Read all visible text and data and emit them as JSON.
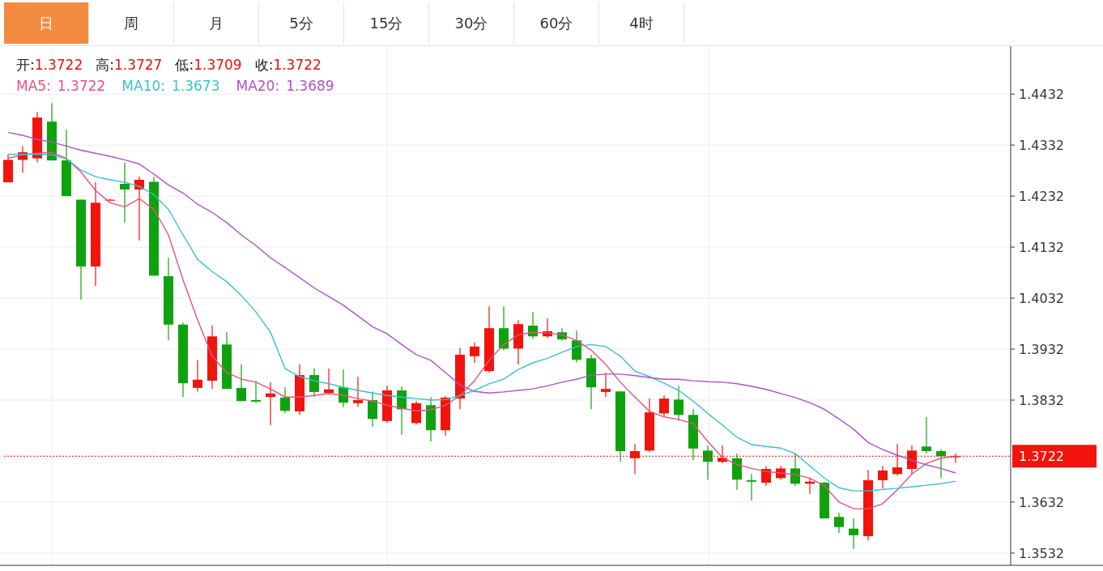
{
  "tabs": [
    {
      "label": "日",
      "selected": true
    },
    {
      "label": "周",
      "selected": false
    },
    {
      "label": "月",
      "selected": false
    },
    {
      "label": "5分",
      "selected": false
    },
    {
      "label": "15分",
      "selected": false
    },
    {
      "label": "30分",
      "selected": false
    },
    {
      "label": "60分",
      "selected": false
    },
    {
      "label": "4时",
      "selected": false
    }
  ],
  "quote": [
    {
      "label": "开:",
      "value": "1.3722"
    },
    {
      "label": "高:",
      "value": "1.3727"
    },
    {
      "label": "低:",
      "value": "1.3709"
    },
    {
      "label": "收:",
      "value": "1.3722"
    }
  ],
  "ma_legend": [
    "1.3722",
    "1.3673",
    "1.3689"
  ],
  "chart_data": {
    "type": "candlestick",
    "grid": true,
    "ylim": [
      1.3508,
      1.4526
    ],
    "ref_lines": [
      {
        "axis": "y",
        "value": 1.3722,
        "label": "1.3722",
        "color": "#f2140c"
      }
    ],
    "yticks": [
      {
        "value": 1.3532,
        "label": "1.3532"
      },
      {
        "value": 1.3632,
        "label": "1.3632"
      },
      {
        "value": 1.3832,
        "label": "1.3832"
      },
      {
        "value": 1.3932,
        "label": "1.3932"
      },
      {
        "value": 1.4032,
        "label": "1.4032"
      },
      {
        "value": 1.4132,
        "label": "1.4132"
      },
      {
        "value": 1.4232,
        "label": "1.4232"
      },
      {
        "value": 1.4332,
        "label": "1.4332"
      },
      {
        "value": 1.4432,
        "label": "1.4432"
      }
    ],
    "ohlc": [
      [
        1.4259,
        1.4314,
        1.4259,
        1.4303
      ],
      [
        1.4303,
        1.433,
        1.4278,
        1.4318
      ],
      [
        1.4306,
        1.4397,
        1.4298,
        1.4386
      ],
      [
        1.4378,
        1.4414,
        1.4302,
        1.4302
      ],
      [
        1.4302,
        1.4362,
        1.4232,
        1.4232
      ],
      [
        1.4225,
        1.4225,
        1.4029,
        1.4094
      ],
      [
        1.4094,
        1.4259,
        1.4056,
        1.4219
      ],
      [
        1.4225,
        1.4227,
        1.4223,
        1.4225
      ],
      [
        1.4256,
        1.4298,
        1.418,
        1.4245
      ],
      [
        1.4245,
        1.427,
        1.4145,
        1.4264
      ],
      [
        1.426,
        1.427,
        1.4076,
        1.4076
      ],
      [
        1.4075,
        1.4111,
        1.3949,
        1.398
      ],
      [
        1.398,
        1.3984,
        1.3838,
        1.3865
      ],
      [
        1.3856,
        1.391,
        1.3849,
        1.3872
      ],
      [
        1.387,
        1.3978,
        1.3854,
        1.3957
      ],
      [
        1.3941,
        1.3965,
        1.3854,
        1.3854
      ],
      [
        1.3856,
        1.3902,
        1.383,
        1.383
      ],
      [
        1.3832,
        1.387,
        1.3827,
        1.3829
      ],
      [
        1.3838,
        1.3867,
        1.3783,
        1.3845
      ],
      [
        1.3837,
        1.3857,
        1.3807,
        1.3811
      ],
      [
        1.381,
        1.3902,
        1.3803,
        1.3881
      ],
      [
        1.3881,
        1.3894,
        1.3838,
        1.3848
      ],
      [
        1.3846,
        1.3894,
        1.3843,
        1.3853
      ],
      [
        1.3857,
        1.3892,
        1.3818,
        1.3827
      ],
      [
        1.3826,
        1.3878,
        1.3819,
        1.3832
      ],
      [
        1.3832,
        1.3849,
        1.378,
        1.3795
      ],
      [
        1.3791,
        1.386,
        1.3787,
        1.3851
      ],
      [
        1.3851,
        1.3859,
        1.3764,
        1.3814
      ],
      [
        1.3787,
        1.383,
        1.3784,
        1.3826
      ],
      [
        1.3822,
        1.3838,
        1.3751,
        1.3773
      ],
      [
        1.3773,
        1.384,
        1.3762,
        1.3837
      ],
      [
        1.3835,
        1.3934,
        1.3814,
        1.3921
      ],
      [
        1.3918,
        1.3945,
        1.3905,
        1.3937
      ],
      [
        1.3889,
        1.4016,
        1.3886,
        1.3973
      ],
      [
        1.3973,
        1.4016,
        1.393,
        1.3933
      ],
      [
        1.3933,
        1.3989,
        1.3902,
        1.3981
      ],
      [
        1.3978,
        1.4005,
        1.3952,
        1.3957
      ],
      [
        1.3957,
        1.3992,
        1.3954,
        1.3967
      ],
      [
        1.3965,
        1.3973,
        1.3949,
        1.3951
      ],
      [
        1.3949,
        1.3968,
        1.3906,
        1.3911
      ],
      [
        1.3914,
        1.3921,
        1.3814,
        1.3857
      ],
      [
        1.3848,
        1.3886,
        1.3838,
        1.3854
      ],
      [
        1.3849,
        1.3849,
        1.3711,
        1.3732
      ],
      [
        1.3718,
        1.3746,
        1.3687,
        1.3732
      ],
      [
        1.3733,
        1.3835,
        1.373,
        1.3808
      ],
      [
        1.3806,
        1.3841,
        1.3799,
        1.3835
      ],
      [
        1.3833,
        1.386,
        1.3791,
        1.3803
      ],
      [
        1.3803,
        1.3814,
        1.3714,
        1.3737
      ],
      [
        1.3733,
        1.3743,
        1.3676,
        1.3711
      ],
      [
        1.3711,
        1.3743,
        1.3708,
        1.3719
      ],
      [
        1.3718,
        1.3727,
        1.3656,
        1.3676
      ],
      [
        1.3675,
        1.3687,
        1.3635,
        1.3672
      ],
      [
        1.367,
        1.3703,
        1.3664,
        1.3697
      ],
      [
        1.3679,
        1.3703,
        1.3676,
        1.3698
      ],
      [
        1.3698,
        1.3727,
        1.3664,
        1.3668
      ],
      [
        1.3668,
        1.3679,
        1.3648,
        1.3672
      ],
      [
        1.367,
        1.3672,
        1.36,
        1.36
      ],
      [
        1.3603,
        1.3611,
        1.3572,
        1.3583
      ],
      [
        1.358,
        1.36,
        1.354,
        1.3567
      ],
      [
        1.3565,
        1.3695,
        1.3557,
        1.3675
      ],
      [
        1.3675,
        1.3703,
        1.3659,
        1.3694
      ],
      [
        1.3687,
        1.3746,
        1.3684,
        1.37
      ],
      [
        1.3697,
        1.3743,
        1.3687,
        1.3733
      ],
      [
        1.3741,
        1.3799,
        1.3727,
        1.3732
      ],
      [
        1.3732,
        1.3735,
        1.3679,
        1.3722
      ],
      [
        1.3722,
        1.3727,
        1.3709,
        1.3722
      ]
    ],
    "series": [
      {
        "name": "MA5:",
        "type": "line",
        "color": "#e8527f",
        "values": [
          1.4306,
          1.4313,
          1.4316,
          1.4318,
          1.4306,
          1.4279,
          1.4243,
          1.4219,
          1.4211,
          1.4227,
          1.4206,
          1.4156,
          1.4068,
          1.3989,
          1.3918,
          1.3886,
          1.3873,
          1.3867,
          1.3854,
          1.3838,
          1.3838,
          1.3841,
          1.3845,
          1.3841,
          1.3835,
          1.383,
          1.3822,
          1.3816,
          1.3811,
          1.3813,
          1.3822,
          1.3841,
          1.387,
          1.391,
          1.3941,
          1.396,
          1.3965,
          1.3964,
          1.396,
          1.3949,
          1.393,
          1.3902,
          1.3867,
          1.3838,
          1.381,
          1.3799,
          1.3794,
          1.3786,
          1.3751,
          1.3719,
          1.3706,
          1.3698,
          1.3692,
          1.3689,
          1.3686,
          1.3679,
          1.3664,
          1.3632,
          1.3619,
          1.3619,
          1.3629,
          1.3656,
          1.3687,
          1.3708,
          1.3718,
          1.3722
        ]
      },
      {
        "name": "MA10:",
        "type": "line",
        "color": "#3cbfd0",
        "values": [
          1.4314,
          1.4314,
          1.4314,
          1.4313,
          1.4305,
          1.4283,
          1.427,
          1.4264,
          1.4259,
          1.4251,
          1.4235,
          1.4206,
          1.4156,
          1.4108,
          1.4084,
          1.4064,
          1.4037,
          1.4005,
          1.3965,
          1.3894,
          1.3878,
          1.387,
          1.3864,
          1.3857,
          1.3851,
          1.3846,
          1.3841,
          1.3838,
          1.3835,
          1.3832,
          1.3833,
          1.3841,
          1.3851,
          1.3864,
          1.3873,
          1.3892,
          1.3905,
          1.3914,
          1.3926,
          1.3937,
          1.3941,
          1.3937,
          1.3918,
          1.3889,
          1.3878,
          1.3865,
          1.3851,
          1.383,
          1.3806,
          1.3783,
          1.3759,
          1.3745,
          1.3741,
          1.3738,
          1.3727,
          1.3703,
          1.3679,
          1.366,
          1.3654,
          1.3654,
          1.3657,
          1.3659,
          1.3662,
          1.3665,
          1.3668,
          1.3673
        ]
      },
      {
        "name": "MA20:",
        "type": "line",
        "color": "#aa55c3",
        "values": [
          1.4357,
          1.4351,
          1.4343,
          1.4338,
          1.433,
          1.4322,
          1.4316,
          1.431,
          1.4303,
          1.4295,
          1.4275,
          1.4254,
          1.4238,
          1.4216,
          1.42,
          1.418,
          1.4156,
          1.4135,
          1.4111,
          1.4092,
          1.4072,
          1.4052,
          1.4035,
          1.4018,
          1.3997,
          1.3976,
          1.3962,
          1.3941,
          1.3921,
          1.391,
          1.3886,
          1.3862,
          1.3849,
          1.3846,
          1.3848,
          1.3851,
          1.3854,
          1.386,
          1.3867,
          1.3873,
          1.3881,
          1.3883,
          1.3883,
          1.388,
          1.3876,
          1.3873,
          1.3873,
          1.387,
          1.3868,
          1.3867,
          1.3864,
          1.3859,
          1.3853,
          1.3845,
          1.3837,
          1.3827,
          1.3814,
          1.3795,
          1.3775,
          1.3749,
          1.3735,
          1.3724,
          1.3714,
          1.3705,
          1.3698,
          1.3689
        ]
      }
    ]
  }
}
